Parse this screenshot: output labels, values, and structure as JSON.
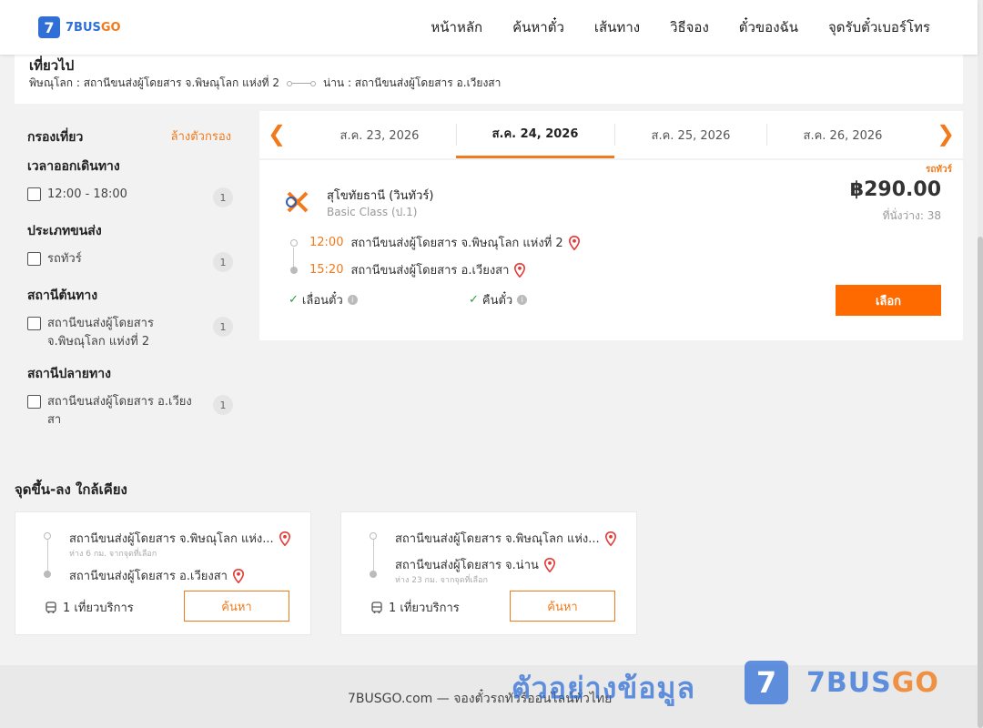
{
  "brand": {
    "logo_number": "7",
    "logo_text_a": "7BUS",
    "logo_text_b": "GO"
  },
  "nav": [
    {
      "label": "หน้าหลัก"
    },
    {
      "label": "ค้นหาตั๋ว"
    },
    {
      "label": "เส้นทาง"
    },
    {
      "label": "วิธีจอง"
    },
    {
      "label": "ตั๋วของฉัน"
    },
    {
      "label": "จุดรับตั๋วเบอร์โทร"
    }
  ],
  "trip": {
    "title": "เที่ยวไป",
    "from": "พิษณุโลก : สถานีขนส่งผู้โดยสาร จ.พิษณุโลก แห่งที่ 2",
    "to": "น่าน : สถานีขนส่งผู้โดยสาร อ.เวียงสา"
  },
  "filter": {
    "title": "กรองเที่ยว",
    "clear_label": "ล้างตัวกรอง",
    "sections": [
      {
        "title": "เวลาออกเดินทาง",
        "option": "12:00 - 18:00",
        "count": "1"
      },
      {
        "title": "ประเภทขนส่ง",
        "option": "รถทัวร์",
        "count": "1"
      },
      {
        "title": "สถานีต้นทาง",
        "option": "สถานีขนส่งผู้โดยสาร จ.พิษณุโลก แห่งที่ 2",
        "count": "1"
      },
      {
        "title": "สถานีปลายทาง",
        "option": "สถานีขนส่งผู้โดยสาร อ.เวียงสา",
        "count": "1"
      }
    ]
  },
  "dates": {
    "prev_icon": "chevron-left-icon",
    "next_icon": "chevron-right-icon",
    "tabs": [
      {
        "label": "ส.ค. 23, 2026",
        "active": false
      },
      {
        "label": "ส.ค. 24, 2026",
        "active": true
      },
      {
        "label": "ส.ค. 25, 2026",
        "active": false
      },
      {
        "label": "ส.ค. 26, 2026",
        "active": false
      }
    ]
  },
  "result": {
    "type_tag": "รถทัวร์",
    "operator": "สุโขทัยธานี (วินทัวร์)",
    "bus_class": "Basic Class (ป.1)",
    "price": "฿290.00",
    "seats": "ที่นั่งว่าง: 38",
    "depart_time": "12:00",
    "depart_station": "สถานีขนส่งผู้โดยสาร จ.พิษณุโลก แห่งที่ 2",
    "arrive_time": "15:20",
    "arrive_station": "สถานีขนส่งผู้โดยสาร อ.เวียงสา",
    "policy_change": "เลื่อนตั๋ว",
    "policy_refund": "คืนตั๋ว",
    "select_label": "เลือก"
  },
  "nearby": {
    "title": "จุดขึ้น-ลง ใกล้เคียง",
    "cards": [
      {
        "from": "สถานีขนส่งผู้โดยสาร จ.พิษณุโลก แห่ง...",
        "from_dist": "ห่าง 6 กม. จากจุดที่เลือก",
        "to": "สถานีขนส่งผู้โดยสาร อ.เวียงสา",
        "to_dist": "",
        "trips": "1 เที่ยวบริการ",
        "button": "ค้นหา"
      },
      {
        "from": "สถานีขนส่งผู้โดยสาร จ.พิษณุโลก แห่ง...",
        "from_dist": "",
        "to": "สถานีขนส่งผู้โดยสาร จ.น่าน",
        "to_dist": "ห่าง 23 กม. จากจุดที่เลือก",
        "trips": "1 เที่ยวบริการ",
        "button": "ค้นหา"
      }
    ]
  },
  "footer": {
    "text": "7BUSGO.com — จองตั๋วรถทัวร์ออนไลน์ทั่วไทย",
    "watermark": "ตัวอย่างข้อมูล",
    "watermark_logo_number": "7",
    "watermark_logo_a": "7BUS",
    "watermark_logo_b": "GO"
  },
  "colors": {
    "accent": "#f07a1c",
    "button": "#ff6a00",
    "brand_blue": "#2f6fd6",
    "check": "#2e9e3e"
  }
}
